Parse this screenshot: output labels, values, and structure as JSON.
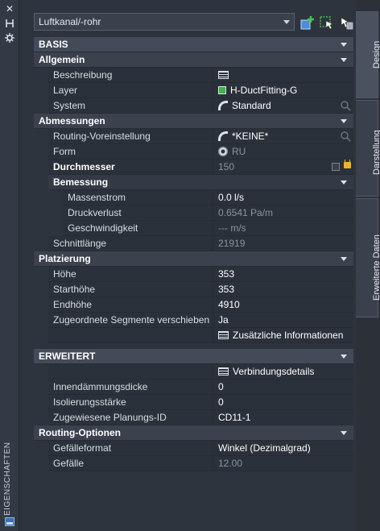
{
  "strip": {
    "title": "EIGENSCHAFTEN"
  },
  "toolbar": {
    "object_type": "Luftkanal/-rohr"
  },
  "tabs": [
    "Design",
    "Darstellung",
    "Erweiterte Daten"
  ],
  "sections": {
    "basis": "BASIS",
    "allgemein": "Allgemein",
    "abmessungen": "Abmessungen",
    "bemessung": "Bemessung",
    "platzierung": "Platzierung",
    "erweitert": "ERWEITERT",
    "routing_optionen": "Routing-Optionen"
  },
  "props": {
    "beschreibung": {
      "name": "Beschreibung",
      "value": ""
    },
    "layer": {
      "name": "Layer",
      "value": "H-DuctFitting-G",
      "color": "#3bb24a"
    },
    "system": {
      "name": "System",
      "value": "Standard"
    },
    "routing_voreinstellung": {
      "name": "Routing-Voreinstellung",
      "value": "*KEINE*"
    },
    "form": {
      "name": "Form",
      "value": "RU"
    },
    "durchmesser": {
      "name": "Durchmesser",
      "value": "150"
    },
    "massenstrom": {
      "name": "Massenstrom",
      "value": "0.0 l/s"
    },
    "druckverlust": {
      "name": "Druckverlust",
      "value": "0.6541 Pa/m"
    },
    "geschwindigkeit": {
      "name": "Geschwindigkeit",
      "value": "--- m/s"
    },
    "schnittlaenge": {
      "name": "Schnittlänge",
      "value": "21919"
    },
    "hoehe": {
      "name": "Höhe",
      "value": "353"
    },
    "starthoehe": {
      "name": "Starthöhe",
      "value": "353"
    },
    "endhoehe": {
      "name": "Endhöhe",
      "value": "4910"
    },
    "segmente": {
      "name": "Zugeordnete Segmente verschieben",
      "value": "Ja"
    },
    "zusatz": {
      "value": "Zusätzliche Informationen"
    },
    "verbindung": {
      "value": "Verbindungsdetails"
    },
    "innendaemmung": {
      "name": "Innendämmungsdicke",
      "value": "0"
    },
    "isolierung": {
      "name": "Isolierungsstärke",
      "value": "0"
    },
    "planungs_id": {
      "name": "Zugewiesene Planungs-ID",
      "value": "CD11-1"
    },
    "gefaelleformat": {
      "name": "Gefälleformat",
      "value": "Winkel (Dezimalgrad)"
    },
    "gefaelle": {
      "name": "Gefälle",
      "value": "12.00"
    }
  }
}
